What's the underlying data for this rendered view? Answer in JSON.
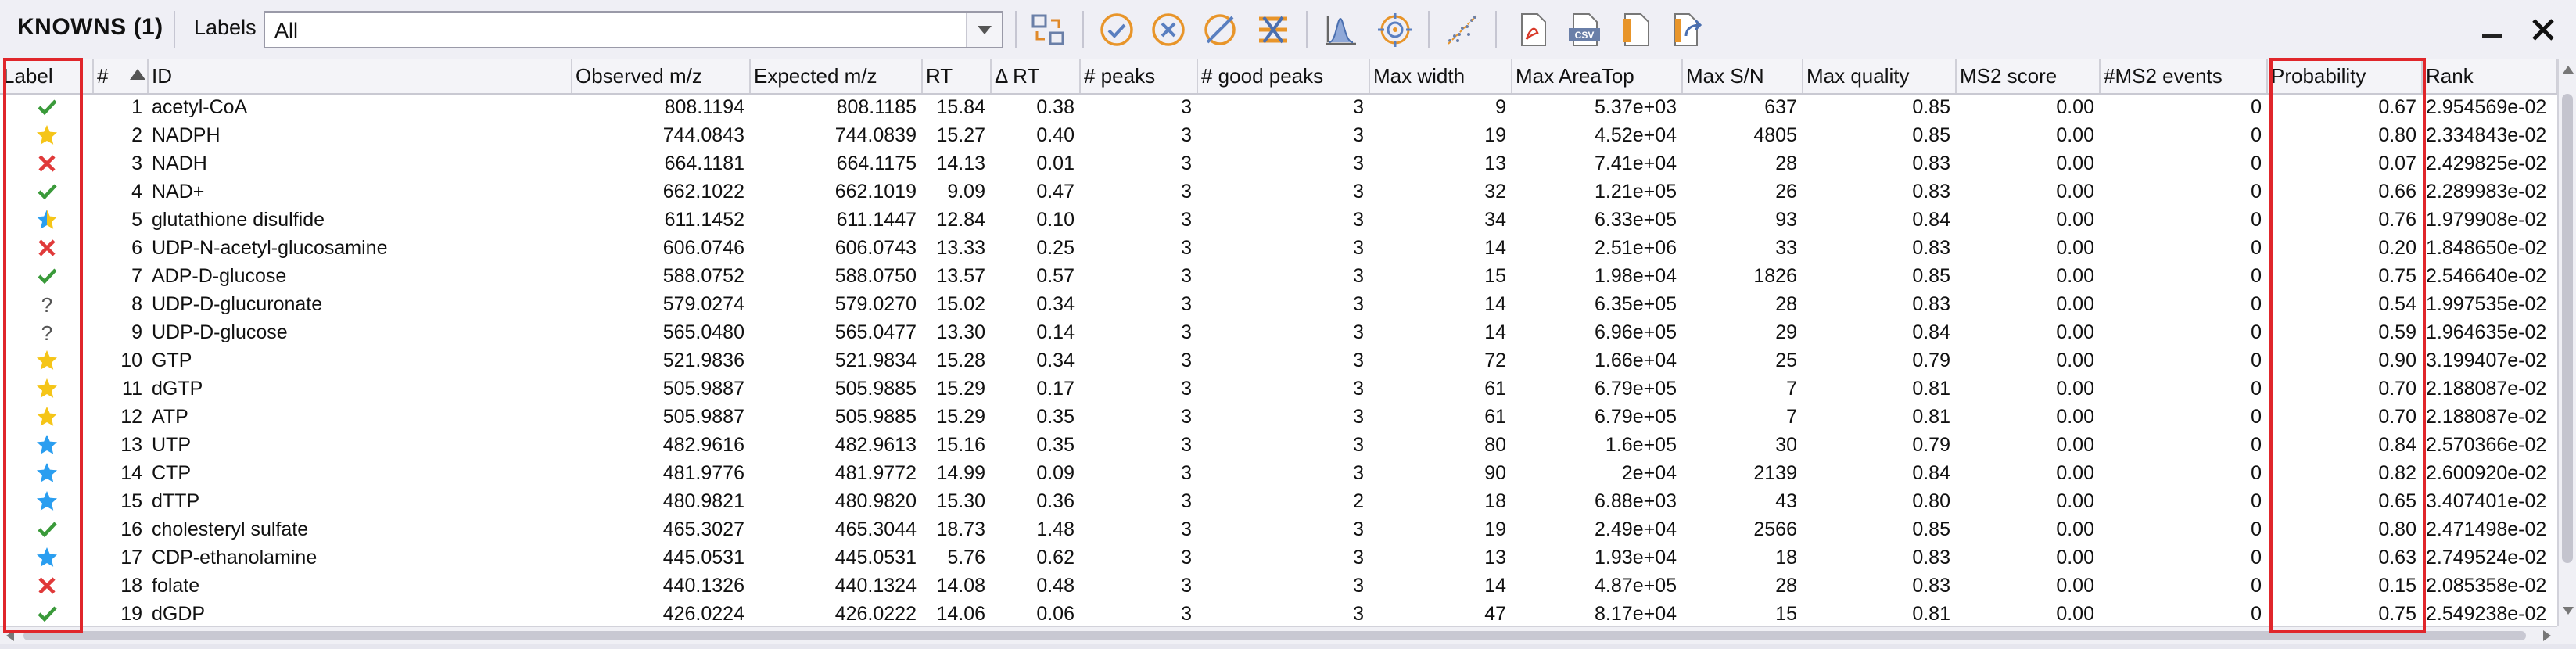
{
  "panel": {
    "title": "KNOWNS (1)"
  },
  "filter": {
    "label": "Labels",
    "value": "All"
  },
  "toolbar_icons": [
    "swap-layout-icon",
    "check-circle-icon",
    "cross-circle-icon",
    "no-label-icon",
    "list-remove-icon",
    "spectrum-icon",
    "target-icon",
    "scatter-icon",
    "pdf-export-icon",
    "csv-export-icon",
    "excel-export-icon",
    "share-export-icon",
    "minimize-icon",
    "close-icon"
  ],
  "colors": {
    "check": "#3a9a3a",
    "cross": "#e03a3a",
    "gold_star": "#f5c518",
    "blue_star": "#2a9ef0",
    "highlight": "#e0262b"
  },
  "columns": [
    "Label",
    "#",
    "ID",
    "Observed m/z",
    "Expected m/z",
    "RT",
    "Δ RT",
    "# peaks",
    "# good peaks",
    "Max width",
    "Max AreaTop",
    "Max S/N",
    "Max quality",
    "MS2 score",
    "#MS2 events",
    "Probability",
    "Rank"
  ],
  "rows": [
    {
      "label": "check",
      "num": "1",
      "id": "acetyl-CoA",
      "obs": "808.1194",
      "exp": "808.1185",
      "rt": "15.84",
      "drt": "0.38",
      "peaks": "3",
      "good": "3",
      "width": "9",
      "area": "5.37e+03",
      "sn": "637",
      "quality": "0.85",
      "ms2": "0.00",
      "events": "0",
      "prob": "0.67",
      "rank": "2.954569e-02"
    },
    {
      "label": "gold-star",
      "num": "2",
      "id": "NADPH",
      "obs": "744.0843",
      "exp": "744.0839",
      "rt": "15.27",
      "drt": "0.40",
      "peaks": "3",
      "good": "3",
      "width": "19",
      "area": "4.52e+04",
      "sn": "4805",
      "quality": "0.85",
      "ms2": "0.00",
      "events": "0",
      "prob": "0.80",
      "rank": "2.334843e-02"
    },
    {
      "label": "cross",
      "num": "3",
      "id": "NADH",
      "obs": "664.1181",
      "exp": "664.1175",
      "rt": "14.13",
      "drt": "0.01",
      "peaks": "3",
      "good": "3",
      "width": "13",
      "area": "7.41e+04",
      "sn": "28",
      "quality": "0.83",
      "ms2": "0.00",
      "events": "0",
      "prob": "0.07",
      "rank": "2.429825e-02"
    },
    {
      "label": "check",
      "num": "4",
      "id": "NAD+",
      "obs": "662.1022",
      "exp": "662.1019",
      "rt": "9.09",
      "drt": "0.47",
      "peaks": "3",
      "good": "3",
      "width": "32",
      "area": "1.21e+05",
      "sn": "26",
      "quality": "0.83",
      "ms2": "0.00",
      "events": "0",
      "prob": "0.66",
      "rank": "2.289983e-02"
    },
    {
      "label": "half-star",
      "num": "5",
      "id": "glutathione disulfide",
      "obs": "611.1452",
      "exp": "611.1447",
      "rt": "12.84",
      "drt": "0.10",
      "peaks": "3",
      "good": "3",
      "width": "34",
      "area": "6.33e+05",
      "sn": "93",
      "quality": "0.84",
      "ms2": "0.00",
      "events": "0",
      "prob": "0.76",
      "rank": "1.979908e-02"
    },
    {
      "label": "cross",
      "num": "6",
      "id": "UDP-N-acetyl-glucosamine",
      "obs": "606.0746",
      "exp": "606.0743",
      "rt": "13.33",
      "drt": "0.25",
      "peaks": "3",
      "good": "3",
      "width": "14",
      "area": "2.51e+06",
      "sn": "33",
      "quality": "0.83",
      "ms2": "0.00",
      "events": "0",
      "prob": "0.20",
      "rank": "1.848650e-02"
    },
    {
      "label": "check",
      "num": "7",
      "id": "ADP-D-glucose",
      "obs": "588.0752",
      "exp": "588.0750",
      "rt": "13.57",
      "drt": "0.57",
      "peaks": "3",
      "good": "3",
      "width": "15",
      "area": "1.98e+04",
      "sn": "1826",
      "quality": "0.85",
      "ms2": "0.00",
      "events": "0",
      "prob": "0.75",
      "rank": "2.546640e-02"
    },
    {
      "label": "question",
      "num": "8",
      "id": "UDP-D-glucuronate",
      "obs": "579.0274",
      "exp": "579.0270",
      "rt": "15.02",
      "drt": "0.34",
      "peaks": "3",
      "good": "3",
      "width": "14",
      "area": "6.35e+05",
      "sn": "28",
      "quality": "0.83",
      "ms2": "0.00",
      "events": "0",
      "prob": "0.54",
      "rank": "1.997535e-02"
    },
    {
      "label": "question",
      "num": "9",
      "id": "UDP-D-glucose",
      "obs": "565.0480",
      "exp": "565.0477",
      "rt": "13.30",
      "drt": "0.14",
      "peaks": "3",
      "good": "3",
      "width": "14",
      "area": "6.96e+05",
      "sn": "29",
      "quality": "0.84",
      "ms2": "0.00",
      "events": "0",
      "prob": "0.59",
      "rank": "1.964635e-02"
    },
    {
      "label": "gold-star",
      "num": "10",
      "id": "GTP",
      "obs": "521.9836",
      "exp": "521.9834",
      "rt": "15.28",
      "drt": "0.34",
      "peaks": "3",
      "good": "3",
      "width": "72",
      "area": "1.66e+04",
      "sn": "25",
      "quality": "0.79",
      "ms2": "0.00",
      "events": "0",
      "prob": "0.90",
      "rank": "3.199407e-02"
    },
    {
      "label": "gold-star",
      "num": "11",
      "id": "dGTP",
      "obs": "505.9887",
      "exp": "505.9885",
      "rt": "15.29",
      "drt": "0.17",
      "peaks": "3",
      "good": "3",
      "width": "61",
      "area": "6.79e+05",
      "sn": "7",
      "quality": "0.81",
      "ms2": "0.00",
      "events": "0",
      "prob": "0.70",
      "rank": "2.188087e-02"
    },
    {
      "label": "gold-star",
      "num": "12",
      "id": "ATP",
      "obs": "505.9887",
      "exp": "505.9885",
      "rt": "15.29",
      "drt": "0.35",
      "peaks": "3",
      "good": "3",
      "width": "61",
      "area": "6.79e+05",
      "sn": "7",
      "quality": "0.81",
      "ms2": "0.00",
      "events": "0",
      "prob": "0.70",
      "rank": "2.188087e-02"
    },
    {
      "label": "blue-star",
      "num": "13",
      "id": "UTP",
      "obs": "482.9616",
      "exp": "482.9613",
      "rt": "15.16",
      "drt": "0.35",
      "peaks": "3",
      "good": "3",
      "width": "80",
      "area": "1.6e+05",
      "sn": "30",
      "quality": "0.79",
      "ms2": "0.00",
      "events": "0",
      "prob": "0.84",
      "rank": "2.570366e-02"
    },
    {
      "label": "blue-star",
      "num": "14",
      "id": "CTP",
      "obs": "481.9776",
      "exp": "481.9772",
      "rt": "14.99",
      "drt": "0.09",
      "peaks": "3",
      "good": "3",
      "width": "90",
      "area": "2e+04",
      "sn": "2139",
      "quality": "0.84",
      "ms2": "0.00",
      "events": "0",
      "prob": "0.82",
      "rank": "2.600920e-02"
    },
    {
      "label": "blue-star",
      "num": "15",
      "id": "dTTP",
      "obs": "480.9821",
      "exp": "480.9820",
      "rt": "15.30",
      "drt": "0.36",
      "peaks": "3",
      "good": "2",
      "width": "18",
      "area": "6.88e+03",
      "sn": "43",
      "quality": "0.80",
      "ms2": "0.00",
      "events": "0",
      "prob": "0.65",
      "rank": "3.407401e-02"
    },
    {
      "label": "check",
      "num": "16",
      "id": "cholesteryl sulfate",
      "obs": "465.3027",
      "exp": "465.3044",
      "rt": "18.73",
      "drt": "1.48",
      "peaks": "3",
      "good": "3",
      "width": "19",
      "area": "2.49e+04",
      "sn": "2566",
      "quality": "0.85",
      "ms2": "0.00",
      "events": "0",
      "prob": "0.80",
      "rank": "2.471498e-02"
    },
    {
      "label": "blue-star",
      "num": "17",
      "id": "CDP-ethanolamine",
      "obs": "445.0531",
      "exp": "445.0531",
      "rt": "5.76",
      "drt": "0.62",
      "peaks": "3",
      "good": "3",
      "width": "13",
      "area": "1.93e+04",
      "sn": "18",
      "quality": "0.83",
      "ms2": "0.00",
      "events": "0",
      "prob": "0.63",
      "rank": "2.749524e-02"
    },
    {
      "label": "cross",
      "num": "18",
      "id": "folate",
      "obs": "440.1326",
      "exp": "440.1324",
      "rt": "14.08",
      "drt": "0.48",
      "peaks": "3",
      "good": "3",
      "width": "14",
      "area": "4.87e+05",
      "sn": "28",
      "quality": "0.83",
      "ms2": "0.00",
      "events": "0",
      "prob": "0.15",
      "rank": "2.085358e-02"
    },
    {
      "label": "check",
      "num": "19",
      "id": "dGDP",
      "obs": "426.0224",
      "exp": "426.0222",
      "rt": "14.06",
      "drt": "0.06",
      "peaks": "3",
      "good": "3",
      "width": "47",
      "area": "8.17e+04",
      "sn": "15",
      "quality": "0.81",
      "ms2": "0.00",
      "events": "0",
      "prob": "0.75",
      "rank": "2.549238e-02"
    }
  ]
}
